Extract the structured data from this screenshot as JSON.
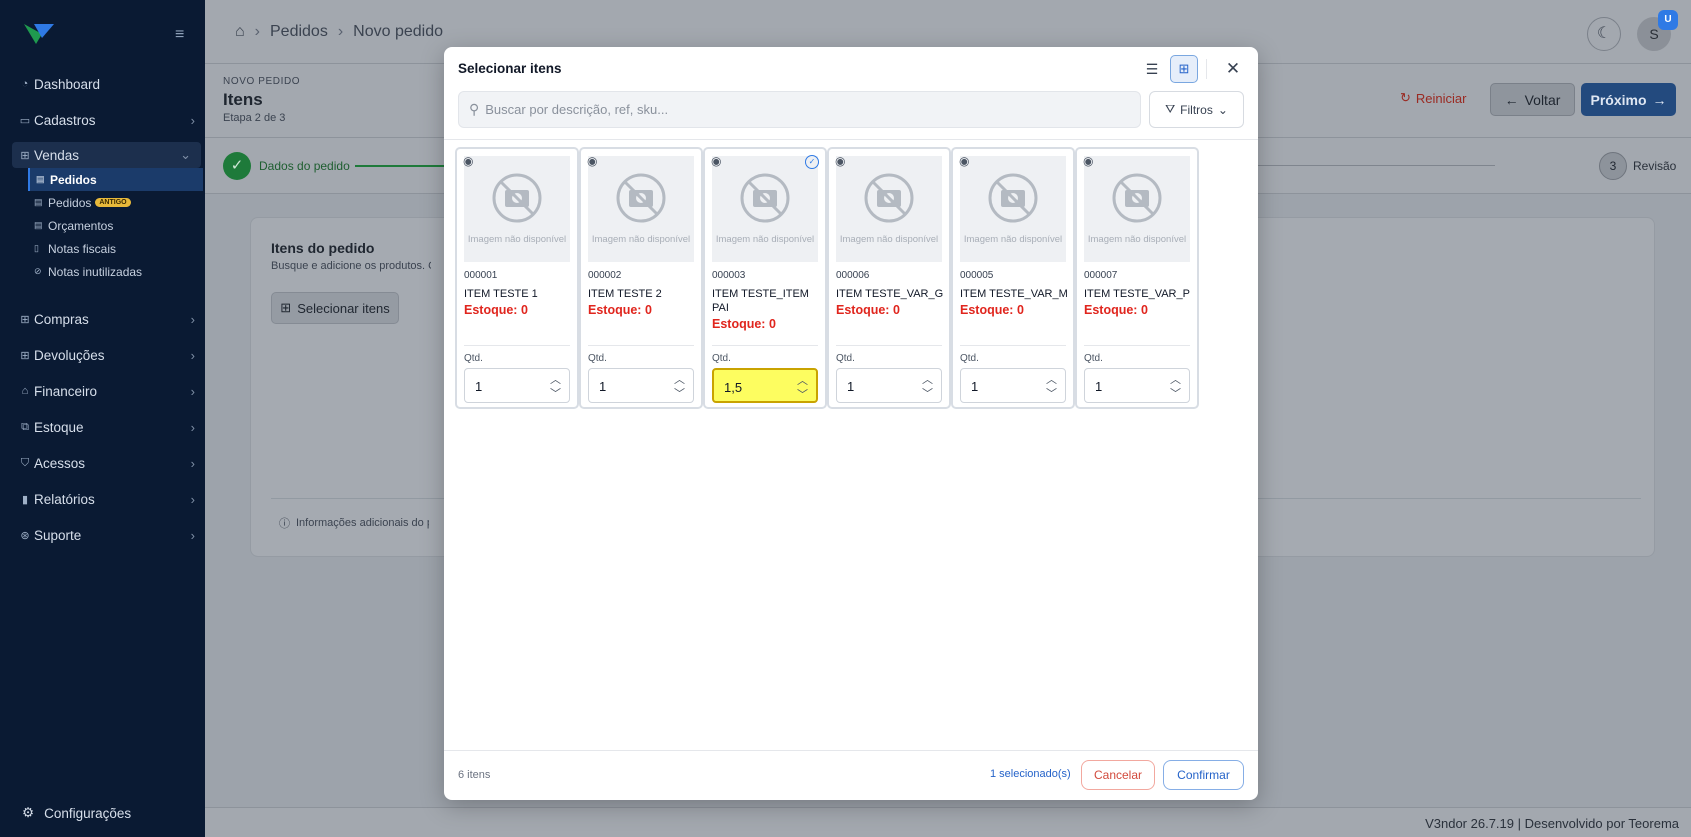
{
  "sidebar": {
    "items": [
      {
        "label": "Dashboard",
        "icon": "dashboard-icon"
      },
      {
        "label": "Cadastros",
        "icon": "id-card-icon"
      },
      {
        "label": "Vendas",
        "icon": "cart-icon"
      }
    ],
    "vendas_sub": [
      {
        "label": "Pedidos",
        "icon": "document-icon"
      },
      {
        "label": "Pedidos",
        "badge": "ANTIGO",
        "icon": "document-icon"
      },
      {
        "label": "Orçamentos",
        "icon": "document-icon"
      },
      {
        "label": "Notas fiscais",
        "icon": "file-icon"
      },
      {
        "label": "Notas inutilizadas",
        "icon": "ban-icon"
      }
    ],
    "items2": [
      {
        "label": "Compras",
        "icon": "cart-icon"
      },
      {
        "label": "Devoluções",
        "icon": "cart-icon"
      },
      {
        "label": "Financeiro",
        "icon": "bank-icon"
      },
      {
        "label": "Estoque",
        "icon": "boxes-icon"
      },
      {
        "label": "Acessos",
        "icon": "shield-icon"
      },
      {
        "label": "Relatórios",
        "icon": "bar-chart-icon"
      },
      {
        "label": "Suporte",
        "icon": "lifebuoy-icon"
      }
    ],
    "config_label": "Configurações"
  },
  "header": {
    "breadcrumb": [
      "Pedidos",
      "Novo pedido"
    ],
    "avatar_initial": "S",
    "avatar_badge": "U"
  },
  "page": {
    "eyebrow": "NOVO PEDIDO",
    "title": "Itens",
    "subtitle": "Etapa 2 de 3",
    "reiniciar": "Reiniciar",
    "voltar": "Voltar",
    "proximo": "Próximo"
  },
  "stepper": {
    "step1": "Dados do pedido",
    "step3_num": "3",
    "step3": "Revisão"
  },
  "card": {
    "title": "Itens do pedido",
    "subtitle": "Busque e adicione os produtos. O p",
    "select_button": "Selecionar itens",
    "info": "Informações adicionais do pe"
  },
  "footer": {
    "text": "V3ndor  26.7.19  |  Desenvolvido por Teorema"
  },
  "modal": {
    "title": "Selecionar itens",
    "search_placeholder": "Buscar por descrição, ref, sku...",
    "filters": "Filtros",
    "no_image": "Imagem não disponível",
    "qty_label": "Qtd.",
    "stock_label": "Estoque: 0",
    "products": [
      {
        "code": "000001",
        "name": "ITEM TESTE 1",
        "qty": "1",
        "selected": false
      },
      {
        "code": "000002",
        "name": "ITEM TESTE 2",
        "qty": "1",
        "selected": false
      },
      {
        "code": "000003",
        "name": "ITEM TESTE_ITEM PAI",
        "qty": "1,5",
        "selected": true
      },
      {
        "code": "000006",
        "name": "ITEM TESTE_VAR_G",
        "qty": "1",
        "selected": false
      },
      {
        "code": "000005",
        "name": "ITEM TESTE_VAR_M",
        "qty": "1",
        "selected": false
      },
      {
        "code": "000007",
        "name": "ITEM TESTE_VAR_P",
        "qty": "1",
        "selected": false
      }
    ],
    "count": "6 itens",
    "selected_count": "1 selecionado(s)",
    "cancel": "Cancelar",
    "confirm": "Confirmar"
  }
}
